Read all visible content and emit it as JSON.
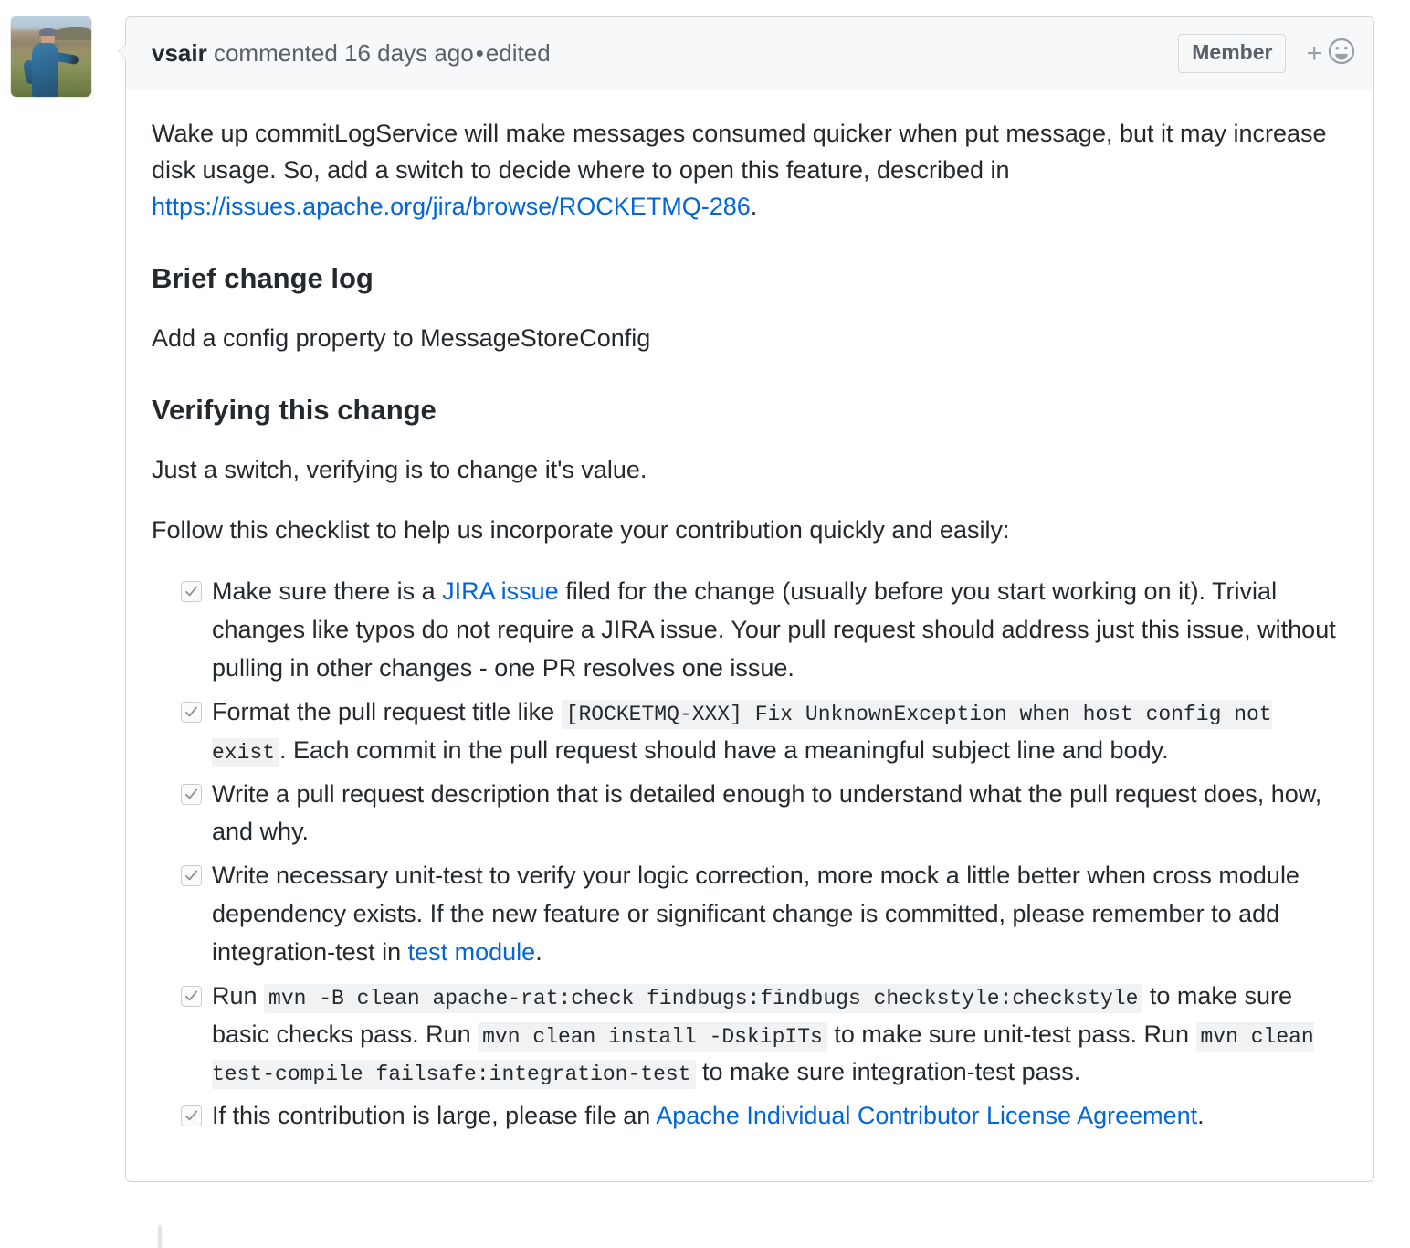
{
  "comment": {
    "author": "vsair",
    "action_text": "commented 16 days ago",
    "separator": "•",
    "edited_label": "edited",
    "member_badge": "Member",
    "reaction_add": "+",
    "reaction_icon": "smiley-face-icon",
    "avatar_alt": "vsair avatar photo"
  },
  "body": {
    "intro_part1": "Wake up commitLogService will make messages consumed quicker when put message, but it may increase disk usage. So, add a switch to decide where to open this feature, described in ",
    "intro_link": "https://issues.apache.org/jira/browse/ROCKETMQ-286",
    "intro_part2": ".",
    "heading_changelog": "Brief change log",
    "changelog_text": "Add a config property to MessageStoreConfig",
    "heading_verifying": "Verifying this change",
    "verifying_text": "Just a switch, verifying is to change it's value.",
    "checklist_intro": "Follow this checklist to help us incorporate your contribution quickly and easily:"
  },
  "checklist": [
    {
      "checked": true,
      "segments": [
        {
          "type": "text",
          "value": "Make sure there is a "
        },
        {
          "type": "link",
          "value": "JIRA issue"
        },
        {
          "type": "text",
          "value": " filed for the change (usually before you start working on it). Trivial changes like typos do not require a JIRA issue. Your pull request should address just this issue, without pulling in other changes - one PR resolves one issue."
        }
      ]
    },
    {
      "checked": true,
      "segments": [
        {
          "type": "text",
          "value": "Format the pull request title like "
        },
        {
          "type": "code",
          "value": "[ROCKETMQ-XXX] Fix UnknownException when host config not exist"
        },
        {
          "type": "text",
          "value": ". Each commit in the pull request should have a meaningful subject line and body."
        }
      ]
    },
    {
      "checked": true,
      "segments": [
        {
          "type": "text",
          "value": "Write a pull request description that is detailed enough to understand what the pull request does, how, and why."
        }
      ]
    },
    {
      "checked": true,
      "segments": [
        {
          "type": "text",
          "value": "Write necessary unit-test to verify your logic correction, more mock a little better when cross module dependency exists. If the new feature or significant change is committed, please remember to add integration-test in "
        },
        {
          "type": "link",
          "value": "test module"
        },
        {
          "type": "text",
          "value": "."
        }
      ]
    },
    {
      "checked": true,
      "segments": [
        {
          "type": "text",
          "value": "Run "
        },
        {
          "type": "code",
          "value": "mvn -B clean apache-rat:check findbugs:findbugs checkstyle:checkstyle"
        },
        {
          "type": "text",
          "value": " to make sure basic checks pass. Run "
        },
        {
          "type": "code",
          "value": "mvn clean install -DskipITs"
        },
        {
          "type": "text",
          "value": " to make sure unit-test pass. Run "
        },
        {
          "type": "code",
          "value": "mvn clean test-compile failsafe:integration-test"
        },
        {
          "type": "text",
          "value": " to make sure integration-test pass."
        }
      ]
    },
    {
      "checked": true,
      "segments": [
        {
          "type": "text",
          "value": "If this contribution is large, please file an "
        },
        {
          "type": "link",
          "value": "Apache Individual Contributor License Agreement"
        },
        {
          "type": "text",
          "value": "."
        }
      ]
    }
  ],
  "colors": {
    "link": "#0366d6",
    "text": "#24292e",
    "muted": "#586069",
    "border": "#d1d5da",
    "header_bg": "#f6f8fa",
    "code_bg": "#f1f2f3"
  }
}
